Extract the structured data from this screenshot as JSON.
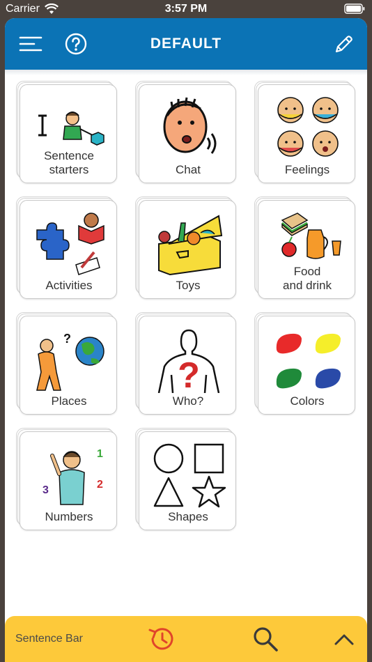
{
  "status_bar": {
    "carrier": "Carrier",
    "time": "3:57 PM",
    "wifi_icon": "wifi-icon",
    "battery_icon": "battery-icon"
  },
  "header": {
    "title": "DEFAULT",
    "background_color": "#0b73b5",
    "menu_icon": "menu-icon",
    "help_icon": "help-icon",
    "edit_icon": "pencil-icon"
  },
  "categories": [
    {
      "label": "Sentence\nstarters",
      "icon": "sentence-starters-icon"
    },
    {
      "label": "Chat",
      "icon": "chat-icon"
    },
    {
      "label": "Feelings",
      "icon": "feelings-icon"
    },
    {
      "label": "Activities",
      "icon": "activities-icon"
    },
    {
      "label": "Toys",
      "icon": "toys-icon"
    },
    {
      "label": "Food\nand drink",
      "icon": "food-and-drink-icon"
    },
    {
      "label": "Places",
      "icon": "places-icon"
    },
    {
      "label": "Who?",
      "icon": "who-icon"
    },
    {
      "label": "Colors",
      "icon": "colors-icon"
    },
    {
      "label": "Numbers",
      "icon": "numbers-icon"
    },
    {
      "label": "Shapes",
      "icon": "shapes-icon"
    }
  ],
  "bottom_bar": {
    "sentence_bar_label": "Sentence Bar",
    "background_color": "#fdc93a",
    "history_icon": "history-icon",
    "search_icon": "search-icon",
    "expand_icon": "chevron-up-icon"
  }
}
